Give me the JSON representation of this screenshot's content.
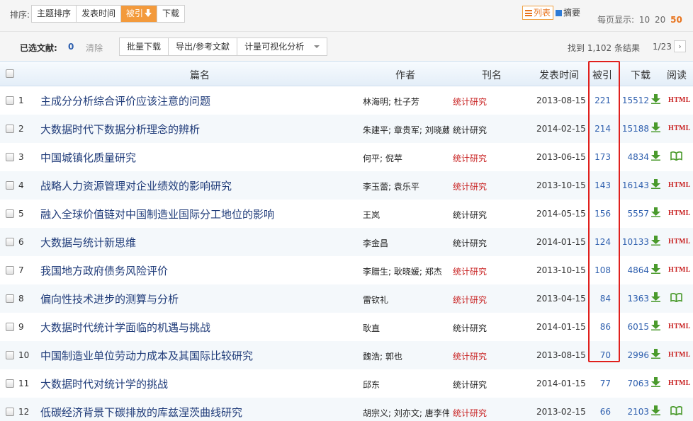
{
  "toolbar": {
    "sort_label": "排序:",
    "sort_options": [
      "主题排序",
      "发表时间",
      "被引",
      "下载"
    ],
    "active_sort": "被引",
    "views": {
      "list": "列表",
      "summary": "摘要"
    },
    "per_page_label": "每页显示:",
    "per_page_options": [
      "10",
      "20",
      "50"
    ],
    "per_page_selected": "50"
  },
  "selection": {
    "label": "已选文献:",
    "count": "0",
    "clear": "清除",
    "actions": [
      "批量下载",
      "导出/参考文献",
      "计量可视化分析"
    ],
    "found": "找到 1,102 条结果",
    "page": "1/23",
    "next": "›"
  },
  "table": {
    "headers": [
      "篇名",
      "作者",
      "刊名",
      "发表时间",
      "被引",
      "下载",
      "阅读"
    ],
    "rows": [
      {
        "num": "1",
        "title": "主成分分析综合评价应该注意的问题",
        "authors": "林海明; 杜子芳",
        "journal": "统计研究",
        "journal_color": "#c82121",
        "date": "2013-08-15",
        "cited": "221",
        "downloads": "15512",
        "read": "HTML"
      },
      {
        "num": "2",
        "title": "大数据时代下数据分析理念的辨析",
        "authors": "朱建平; 章贵军; 刘晓葳",
        "journal": "统计研究",
        "journal_color": "#222222",
        "date": "2014-02-15",
        "cited": "214",
        "downloads": "15188",
        "read": "HTML"
      },
      {
        "num": "3",
        "title": "中国城镇化质量研究",
        "authors": "何平; 倪苹",
        "journal": "统计研究",
        "journal_color": "#c82121",
        "date": "2013-06-15",
        "cited": "173",
        "downloads": "4834",
        "read": "book"
      },
      {
        "num": "4",
        "title": "战略人力资源管理对企业绩效的影响研究",
        "authors": "李玉蕾; 袁乐平",
        "journal": "统计研究",
        "journal_color": "#c82121",
        "date": "2013-10-15",
        "cited": "143",
        "downloads": "16143",
        "read": "HTML"
      },
      {
        "num": "5",
        "title": "融入全球价值链对中国制造业国际分工地位的影响",
        "authors": "王岚",
        "journal": "统计研究",
        "journal_color": "#222222",
        "date": "2014-05-15",
        "cited": "156",
        "downloads": "5557",
        "read": "HTML"
      },
      {
        "num": "6",
        "title": "大数据与统计新思维",
        "authors": "李金昌",
        "journal": "统计研究",
        "journal_color": "#222222",
        "date": "2014-01-15",
        "cited": "124",
        "downloads": "10133",
        "read": "HTML"
      },
      {
        "num": "7",
        "title": "我国地方政府债务风险评价",
        "authors": "李腊生; 耿晓媛; 郑杰",
        "journal": "统计研究",
        "journal_color": "#c82121",
        "date": "2013-10-15",
        "cited": "108",
        "downloads": "4864",
        "read": "HTML"
      },
      {
        "num": "8",
        "title": "偏向性技术进步的测算与分析",
        "authors": "雷钦礼",
        "journal": "统计研究",
        "journal_color": "#c82121",
        "date": "2013-04-15",
        "cited": "84",
        "downloads": "1363",
        "read": "book"
      },
      {
        "num": "9",
        "title": "大数据时代统计学面临的机遇与挑战",
        "authors": "耿直",
        "journal": "统计研究",
        "journal_color": "#222222",
        "date": "2014-01-15",
        "cited": "86",
        "downloads": "6015",
        "read": "HTML"
      },
      {
        "num": "10",
        "title": "中国制造业单位劳动力成本及其国际比较研究",
        "authors": "魏浩; 郭也",
        "journal": "统计研究",
        "journal_color": "#c82121",
        "date": "2013-08-15",
        "cited": "70",
        "downloads": "2996",
        "read": "HTML"
      },
      {
        "num": "11",
        "title": "大数据时代对统计学的挑战",
        "authors": "邱东",
        "journal": "统计研究",
        "journal_color": "#222222",
        "date": "2014-01-15",
        "cited": "77",
        "downloads": "7063",
        "read": "HTML"
      },
      {
        "num": "12",
        "title": "低碳经济背景下碳排放的库兹涅茨曲线研究",
        "authors": "胡宗义; 刘亦文; 唐李伟",
        "journal": "统计研究",
        "journal_color": "#c82121",
        "date": "2013-02-15",
        "cited": "66",
        "downloads": "2103",
        "read": "book"
      }
    ]
  },
  "colors": {
    "accent_orange": "#f39a3c",
    "title_blue": "#1f3b79",
    "link_blue": "#2e5fae",
    "highlight_red": "#e0201d",
    "download_green": "#4a9a2c"
  }
}
